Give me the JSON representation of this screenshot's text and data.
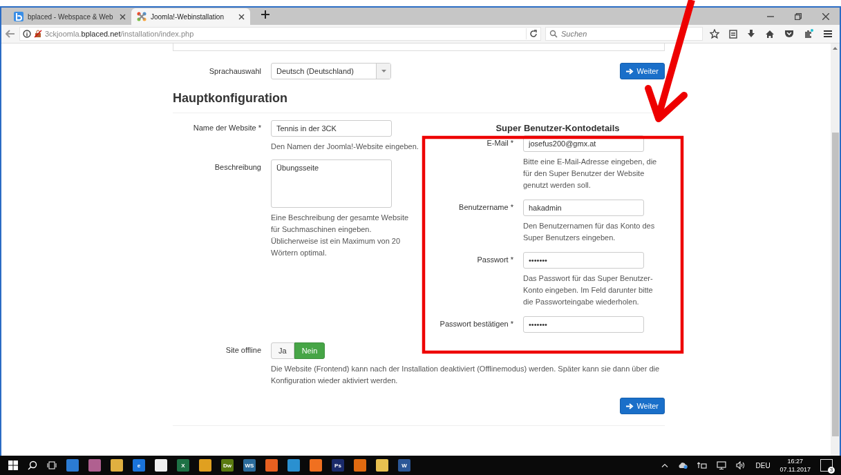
{
  "browser": {
    "tabs": [
      {
        "title": "bplaced - Webspace & Web",
        "selected": false
      },
      {
        "title": "Joomla!-Webinstallation",
        "selected": true
      }
    ],
    "url": "3ckjoomla.**bplaced.net**/installation/index.php",
    "search": {
      "placeholder": "Suchen"
    }
  },
  "language": {
    "label": "Sprachauswahl",
    "value": "Deutsch (Deutschland)",
    "button": "Weiter"
  },
  "heading": "Hauptkonfiguration",
  "site_fields": [
    {
      "label": "Name der Website *",
      "kind": "input",
      "value": "Tennis in der 3CK",
      "help": "Den Namen der Joomla!-Website eingeben."
    },
    {
      "label": "Beschreibung",
      "kind": "textarea",
      "value": "Übungsseite",
      "help": "Eine Beschreibung der gesamte Website für Suchmaschinen eingeben. Üblicherweise ist ein Maximum von 20 Wörtern optimal."
    }
  ],
  "admin": {
    "title": "Super Benutzer-Kontodetails",
    "fields": [
      {
        "label": "E-Mail *",
        "value": "josefus200@gmx.at",
        "help": "Bitte eine E-Mail-Adresse eingeben, die für den Super Benutzer der Website genutzt werden soll."
      },
      {
        "label": "Benutzername *",
        "value": "hakadmin",
        "help": "Den Benutzernamen für das Konto des Super Benutzers eingeben."
      },
      {
        "label": "Passwort *",
        "value": "•••••••",
        "help": "Das Passwort für das Super Benutzer-Konto eingeben. Im Feld darunter bitte die Passworteingabe wiederholen."
      },
      {
        "label": "Passwort bestätigen *",
        "value": "•••••••"
      }
    ]
  },
  "offline": {
    "label": "Site offline",
    "options": [
      {
        "label": "Ja",
        "selected": false
      },
      {
        "label": "Nein",
        "selected": true
      }
    ],
    "help": "Die Website (Frontend) kann nach der Installation deaktiviert (Offlinemodus) werden. Später kann sie dann über die Konfiguration wieder aktiviert werden."
  },
  "next_button": "Weiter",
  "taskbar": {
    "apps": [
      {
        "color": "#2b7bd3"
      },
      {
        "color": "#b06090"
      },
      {
        "color": "#e0b040"
      },
      {
        "color": "#1a73d9",
        "glyph": "e"
      },
      {
        "color": "#f0f0f0"
      },
      {
        "color": "#1e7145",
        "glyph": "X"
      },
      {
        "color": "#e0a020"
      },
      {
        "color": "#5a7a10",
        "glyph": "Dw"
      },
      {
        "color": "#2a6a9a",
        "glyph": "WS"
      },
      {
        "color": "#e86020"
      },
      {
        "color": "#2a90d0"
      },
      {
        "color": "#f07020"
      },
      {
        "color": "#1a2a6a",
        "glyph": "Ps"
      },
      {
        "color": "#e06a10"
      },
      {
        "color": "#e8c050"
      },
      {
        "color": "#2b5797",
        "glyph": "W"
      }
    ],
    "language": "DEU",
    "time": "16:27",
    "date": "07.11.2017",
    "notifications": "3"
  }
}
